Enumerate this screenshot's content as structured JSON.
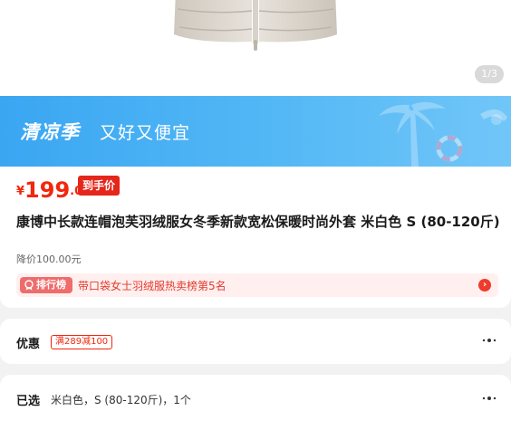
{
  "gallery": {
    "page_indicator": "1/3"
  },
  "banner": {
    "title": "清凉季",
    "subtitle": "又好又便宜",
    "color": "#3aa6f2"
  },
  "price": {
    "currency": "¥",
    "integer": "199",
    "decimal": ".00",
    "tag": "到手价",
    "color": "#f2270c"
  },
  "product": {
    "title": "康博中长款连帽泡芙羽绒服女冬季新款宽松保暖时尚外套 米白色 S (80-120斤)",
    "reduction": "降价100.00元"
  },
  "ranking": {
    "badge": "排行榜",
    "text": "带口袋女士羽绒服热卖榜第5名"
  },
  "discount": {
    "label": "优惠",
    "coupon": "满289减100"
  },
  "selection": {
    "label": "已选",
    "value": "米白色，S (80-120斤)，1个"
  }
}
